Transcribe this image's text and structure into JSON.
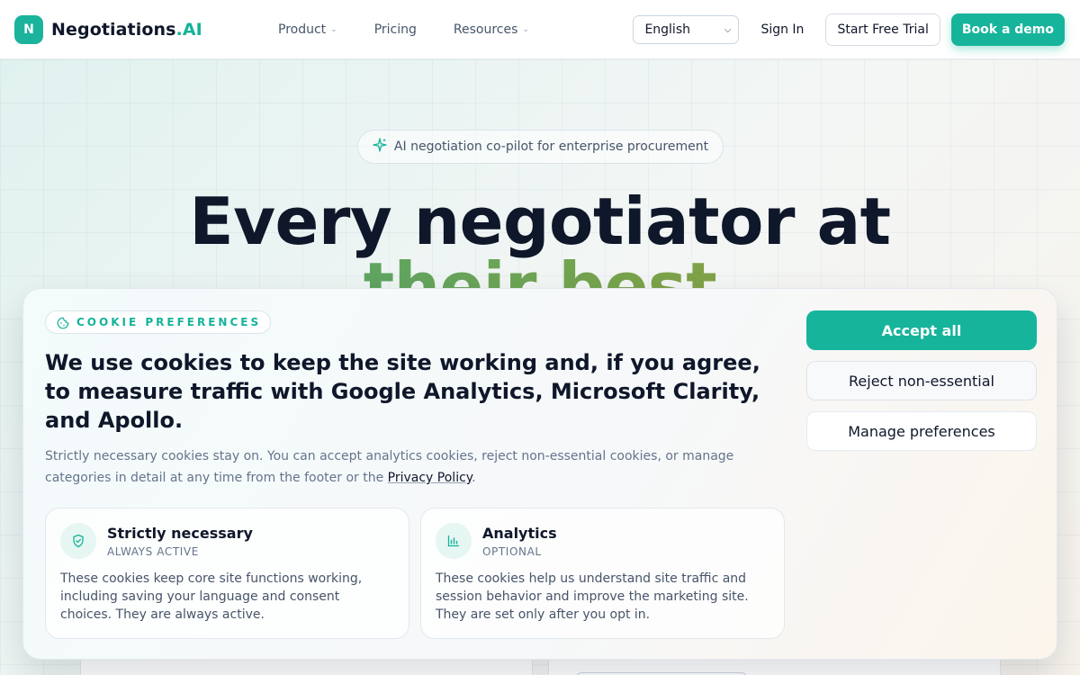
{
  "header": {
    "brand_mark": "N",
    "brand_name": "Negotiations",
    "brand_suffix": ".AI",
    "nav": [
      {
        "label": "Product",
        "has_dropdown": true
      },
      {
        "label": "Pricing",
        "has_dropdown": false
      },
      {
        "label": "Resources",
        "has_dropdown": true
      }
    ],
    "language_selected": "English",
    "sign_in": "Sign In",
    "start_trial": "Start Free Trial",
    "book_demo": "Book a demo"
  },
  "hero": {
    "pill_text": "AI negotiation co-pilot for enterprise procurement",
    "title_line1": "Every negotiator at",
    "title_line2": "their best"
  },
  "cookie_banner": {
    "tag": "COOKIE PREFERENCES",
    "heading": "We use cookies to keep the site working and, if you agree, to measure traffic with Google Analytics, Microsoft Clarity, and Apollo.",
    "description_before_link": "Strictly necessary cookies stay on. You can accept analytics cookies, reject non-essential cookies, or manage categories in detail at any time from the footer or the ",
    "privacy_link": "Privacy Policy",
    "description_after_link": ".",
    "categories": [
      {
        "title": "Strictly necessary",
        "status": "ALWAYS ACTIVE",
        "body": "These cookies keep core site functions working, including saving your language and consent choices. They are always active.",
        "icon": "shield-check-icon"
      },
      {
        "title": "Analytics",
        "status": "OPTIONAL",
        "body": "These cookies help us understand site traffic and session behavior and improve the marketing site. They are set only after you opt in.",
        "icon": "bar-chart-icon"
      }
    ],
    "accept_all": "Accept all",
    "reject_non_essential": "Reject non-essential",
    "manage_preferences": "Manage preferences"
  },
  "colors": {
    "accent": "#17b49c",
    "text_primary": "#0f172a",
    "text_muted": "#64748b"
  }
}
